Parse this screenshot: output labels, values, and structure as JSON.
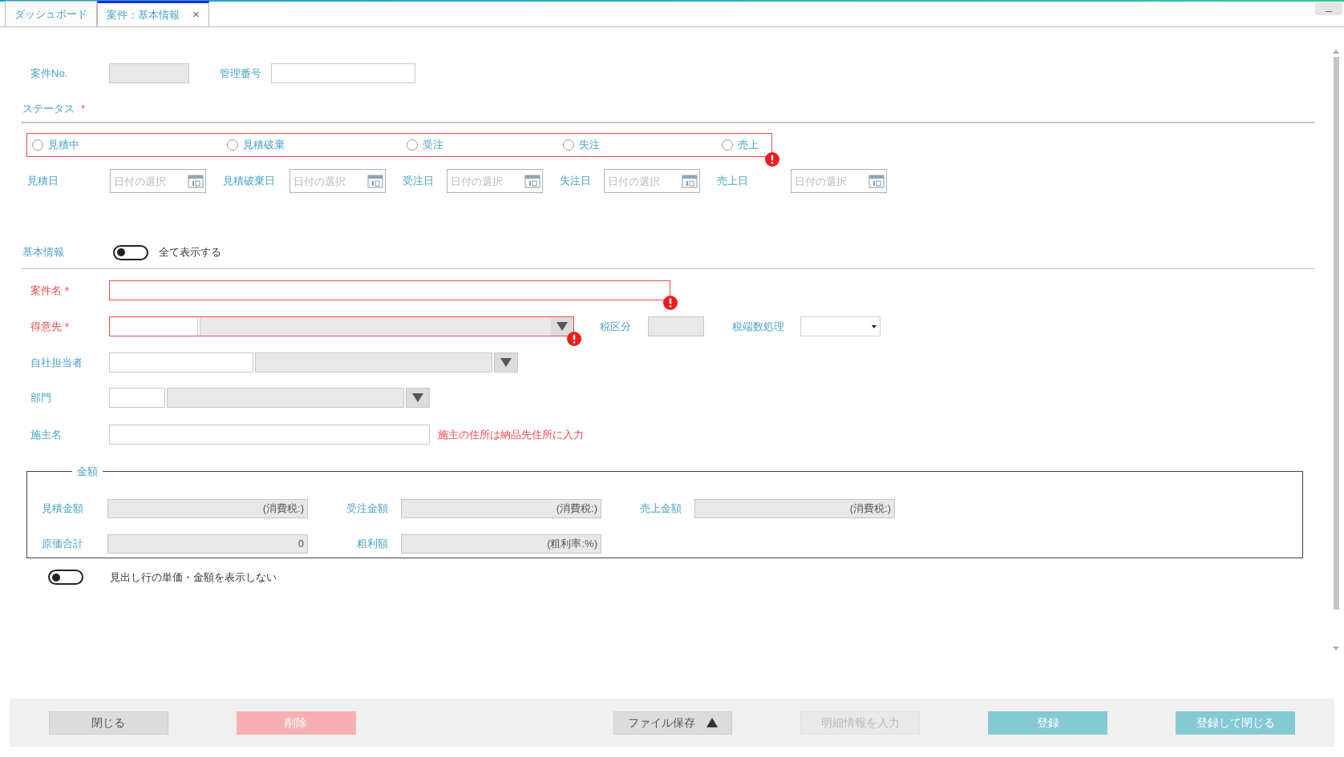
{
  "tabs": [
    {
      "label": "ダッシュボード",
      "selected": false
    },
    {
      "label": "案件：基本情報",
      "selected": true,
      "close": "×"
    }
  ],
  "header": {
    "case_no": {
      "label": "案件No.",
      "disabled": true
    },
    "management_no": {
      "label": "管理番号",
      "disabled": false
    }
  },
  "status": {
    "label": "ステータス",
    "required_mark": "*",
    "error": true,
    "options": [
      {
        "label": "見積中",
        "selected": false
      },
      {
        "label": "見積破棄",
        "selected": false
      },
      {
        "label": "受注",
        "selected": false
      },
      {
        "label": "失注",
        "selected": false
      },
      {
        "label": "売上",
        "selected": false
      }
    ]
  },
  "dates": [
    {
      "label": "見積日",
      "placeholder": "日付の選択"
    },
    {
      "label": "見積破棄日",
      "placeholder": "日付の選択"
    },
    {
      "label": "受注日",
      "placeholder": "日付の選択"
    },
    {
      "label": "失注日",
      "placeholder": "日付の選択"
    },
    {
      "label": "売上日",
      "placeholder": "日付の選択"
    }
  ],
  "basic_info": {
    "label": "基本情報",
    "show_all": {
      "label": "全て表示する",
      "on": false
    }
  },
  "case_name": {
    "label": "案件名＊",
    "required": true,
    "error": true
  },
  "customer": {
    "label": "得意先＊",
    "required": true,
    "error": true
  },
  "tax_category": {
    "label": "税区分"
  },
  "tax_rounding": {
    "label": "税端数処理"
  },
  "staff": {
    "label": "自社担当者",
    "required": false
  },
  "department": {
    "label": "部門",
    "required": false
  },
  "owner": {
    "label": "施主名",
    "note": "施主の住所は納品先住所に入力"
  },
  "amounts": {
    "legend": "金額",
    "rows": [
      [
        {
          "label": "見積金額",
          "value": "(消費税:)"
        },
        {
          "label": "受注金額",
          "value": "(消費税:)"
        },
        {
          "label": "売上金額",
          "value": "(消費税:)"
        }
      ],
      [
        {
          "label": "原価合計",
          "value": "0"
        },
        {
          "label": "粗利額",
          "value": "(粗利率:%)"
        }
      ]
    ]
  },
  "hide_headline_prices": {
    "label": "見出し行の単価・金額を表示しない",
    "on": false
  },
  "buttons": [
    {
      "label": "閉じる",
      "kind": "plain",
      "disabled": false
    },
    {
      "label": "削除",
      "kind": "danger",
      "disabled": true
    },
    {
      "label": "ファイル保存",
      "kind": "menu",
      "disabled": false
    },
    {
      "label": "明細情報を入力",
      "kind": "plain",
      "disabled": true
    },
    {
      "label": "登録",
      "kind": "primary",
      "disabled": false
    },
    {
      "label": "登録して閉じる",
      "kind": "primary",
      "disabled": false
    }
  ]
}
